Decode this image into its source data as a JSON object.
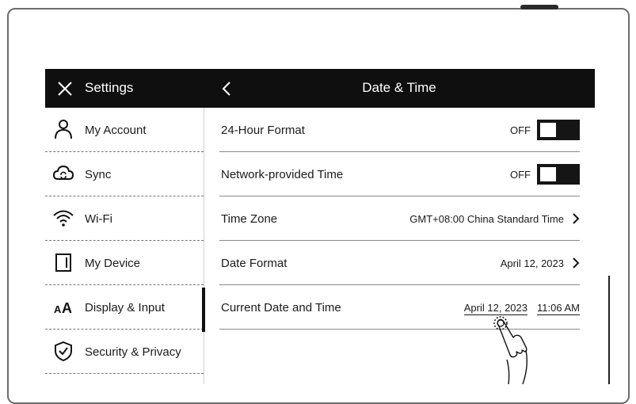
{
  "sidebar": {
    "title": "Settings",
    "items": [
      {
        "label": "My Account",
        "icon": "person-icon"
      },
      {
        "label": "Sync",
        "icon": "cloud-sync-icon"
      },
      {
        "label": "Wi-Fi",
        "icon": "wifi-icon"
      },
      {
        "label": "My Device",
        "icon": "device-icon"
      },
      {
        "label": "Display & Input",
        "icon": "text-size-icon",
        "active": true
      },
      {
        "label": "Security & Privacy",
        "icon": "shield-icon"
      }
    ]
  },
  "header": {
    "title": "Date & Time"
  },
  "rows": [
    {
      "label": "24-Hour Format",
      "state": "OFF"
    },
    {
      "label": "Network-provided Time",
      "state": "OFF"
    },
    {
      "label": "Time Zone",
      "value": "GMT+08:00 China Standard Time"
    },
    {
      "label": "Date Format",
      "value": "April 12, 2023"
    },
    {
      "label": "Current Date and Time",
      "date": "April 12, 2023",
      "time": "11:06 AM"
    }
  ],
  "colors": {
    "bar": "#0f0f0f",
    "text": "#1a1a1a",
    "background": "#ffffff"
  }
}
